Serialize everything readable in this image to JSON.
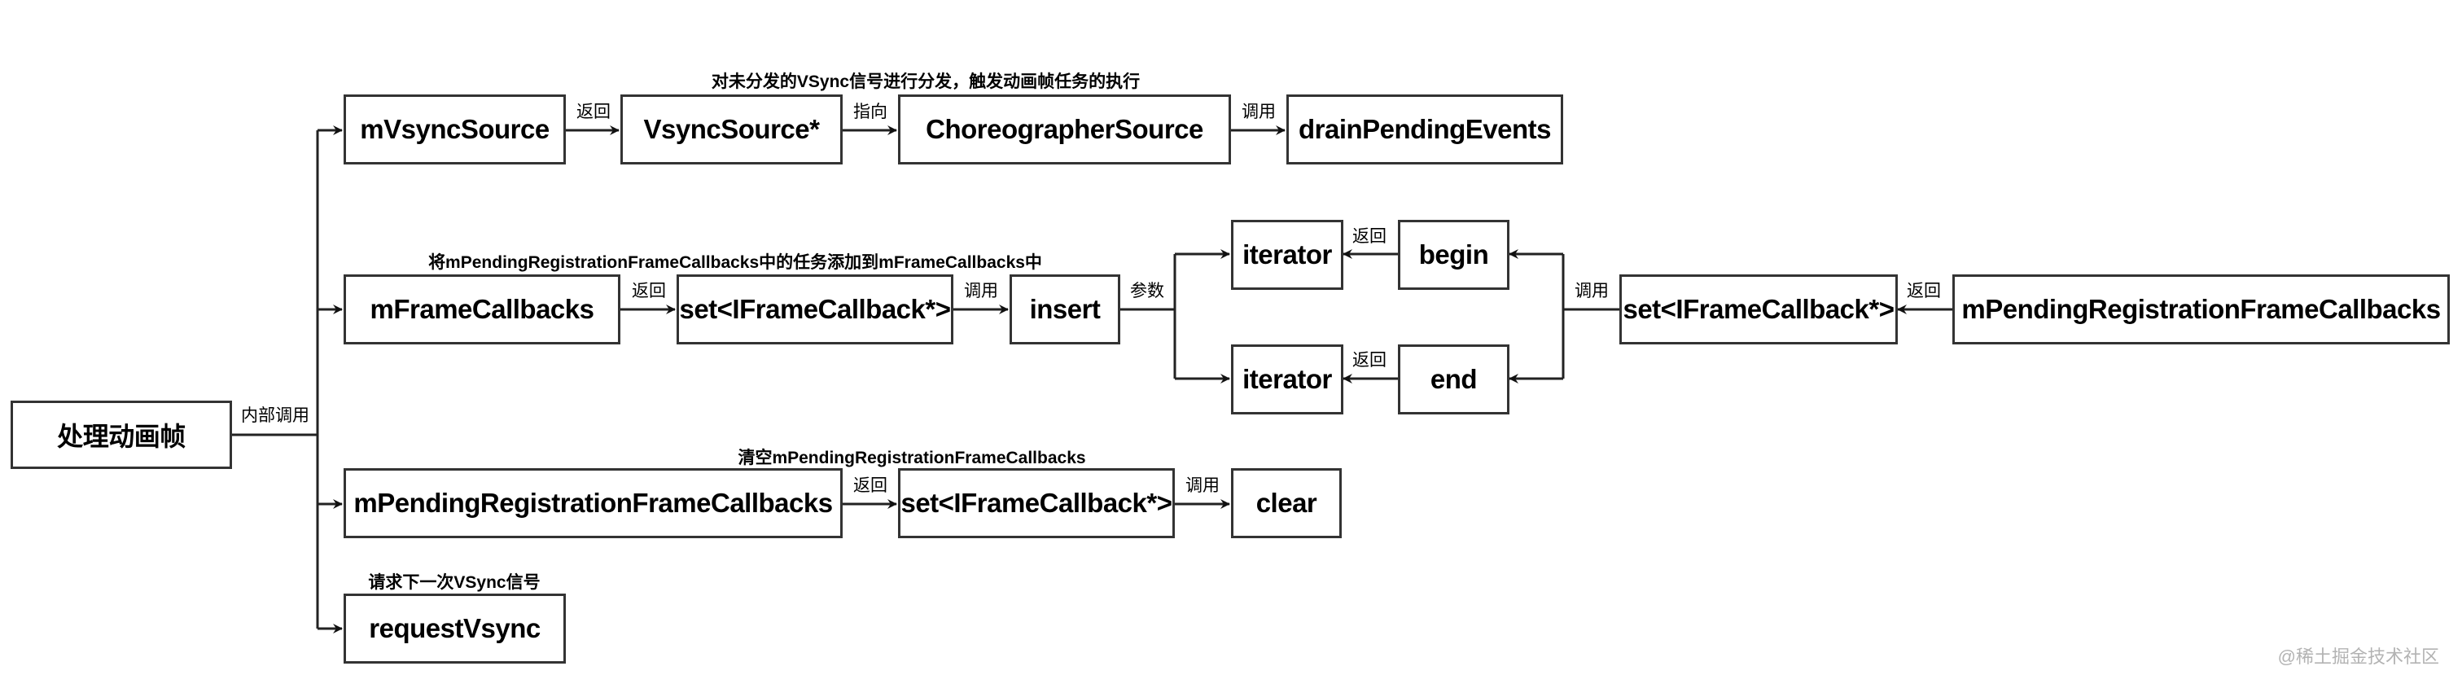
{
  "root": {
    "label": "处理动画帧",
    "edge_label": "内部调用"
  },
  "rows": [
    {
      "note": "对未分发的VSync信号进行分发，触发动画帧任务的执行",
      "nodes": [
        "mVsyncSource",
        "VsyncSource*",
        "ChoreographerSource",
        "drainPendingEvents"
      ],
      "edges": [
        "返回",
        "指向",
        "调用"
      ]
    },
    {
      "note": "将mPendingRegistrationFrameCallbacks中的任务添加到mFrameCallbacks中",
      "nodes": [
        "mFrameCallbacks",
        "set<IFrameCallback*>",
        "insert"
      ],
      "edges": [
        "返回",
        "调用",
        "参数"
      ],
      "iter_top": "iterator",
      "iter_bottom": "iterator",
      "begin": "begin",
      "end": "end",
      "begin_edge": "返回",
      "end_edge": "返回",
      "call_edge": "调用",
      "right_set": "set<IFrameCallback*>",
      "right_source": "mPendingRegistrationFrameCallbacks",
      "right_edge": "返回"
    },
    {
      "note": "清空mPendingRegistrationFrameCallbacks",
      "nodes": [
        "mPendingRegistrationFrameCallbacks",
        "set<IFrameCallback*>",
        "clear"
      ],
      "edges": [
        "返回",
        "调用"
      ]
    },
    {
      "note": "请求下一次VSync信号",
      "nodes": [
        "requestVsync"
      ]
    }
  ],
  "watermark": "@稀土掘金技术社区"
}
